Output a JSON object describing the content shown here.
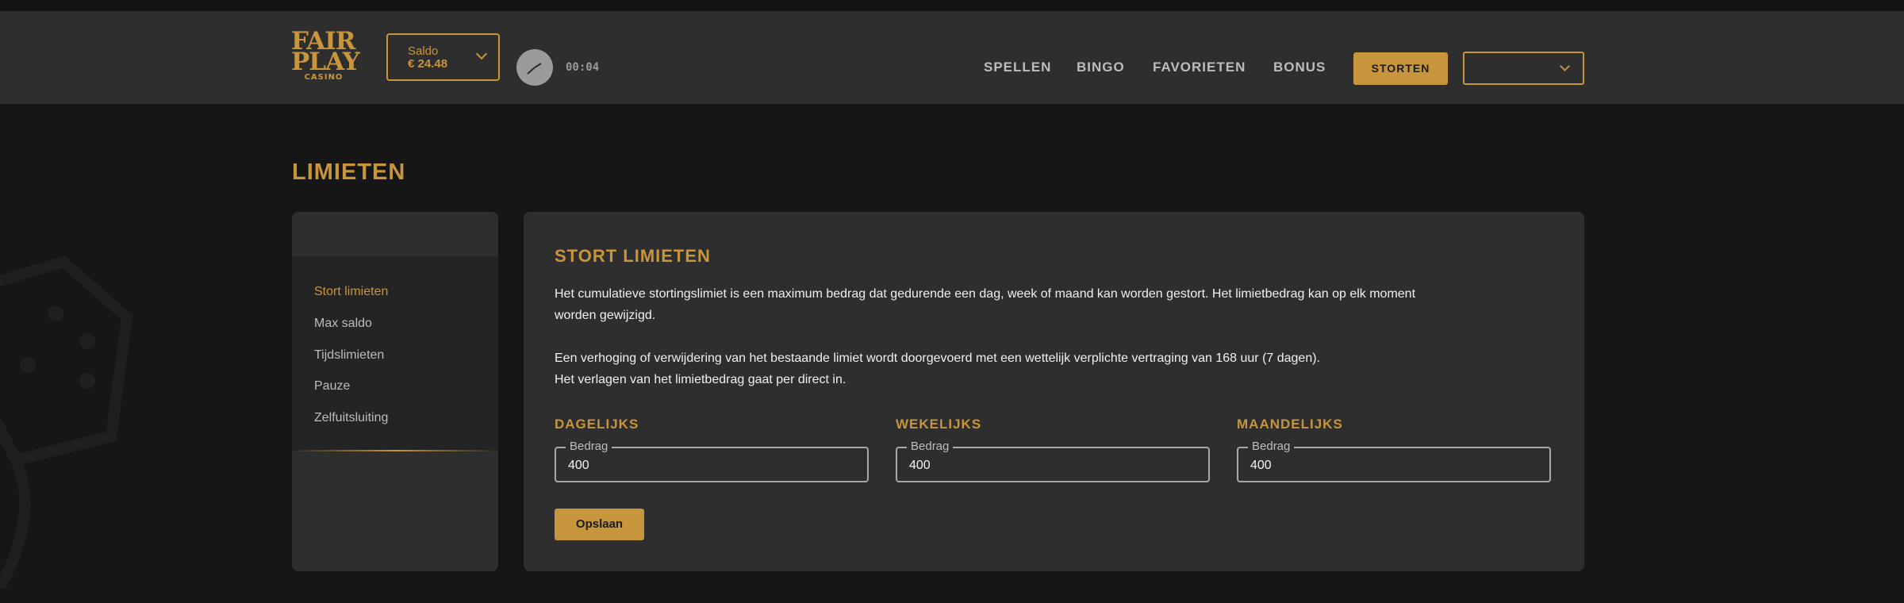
{
  "header": {
    "logo": {
      "line1": "FAIR",
      "line2": "PLAY",
      "line3": "CASINO"
    },
    "saldo": {
      "label": "Saldo",
      "value": "€ 24.48"
    },
    "timer": "00:04",
    "nav": [
      "SPELLEN",
      "BINGO",
      "FAVORIETEN",
      "BONUS"
    ],
    "deposit_button": "STORTEN",
    "language_select": ""
  },
  "page": {
    "title": "LIMIETEN"
  },
  "sidebar": {
    "items": [
      {
        "label": "Stort limieten",
        "active": true
      },
      {
        "label": "Max saldo",
        "active": false
      },
      {
        "label": "Tijdslimieten",
        "active": false
      },
      {
        "label": "Pauze",
        "active": false
      },
      {
        "label": "Zelfuitsluiting",
        "active": false
      }
    ]
  },
  "panel": {
    "title": "STORT LIMIETEN",
    "para1_line1": "Het cumulatieve stortingslimiet is een maximum bedrag dat gedurende een dag, week of maand kan worden gestort. Het limietbedrag kan op elk moment",
    "para1_line2": "worden gewijzigd.",
    "para2_line1": "Een verhoging of verwijdering van het bestaande limiet wordt doorgevoerd met een wettelijk verplichte vertraging van 168 uur (7 dagen).",
    "para2_line2": "Het verlagen van het limietbedrag gaat per direct in.",
    "limits": [
      {
        "label": "DAGELIJKS",
        "field_label": "Bedrag",
        "value": "400"
      },
      {
        "label": "WEKELIJKS",
        "field_label": "Bedrag",
        "value": "400"
      },
      {
        "label": "MAANDELIJKS",
        "field_label": "Bedrag",
        "value": "400"
      }
    ],
    "save_button": "Opslaan"
  },
  "colors": {
    "accent": "#c7953b",
    "background": "#161616",
    "surface": "#2e2e2e"
  }
}
